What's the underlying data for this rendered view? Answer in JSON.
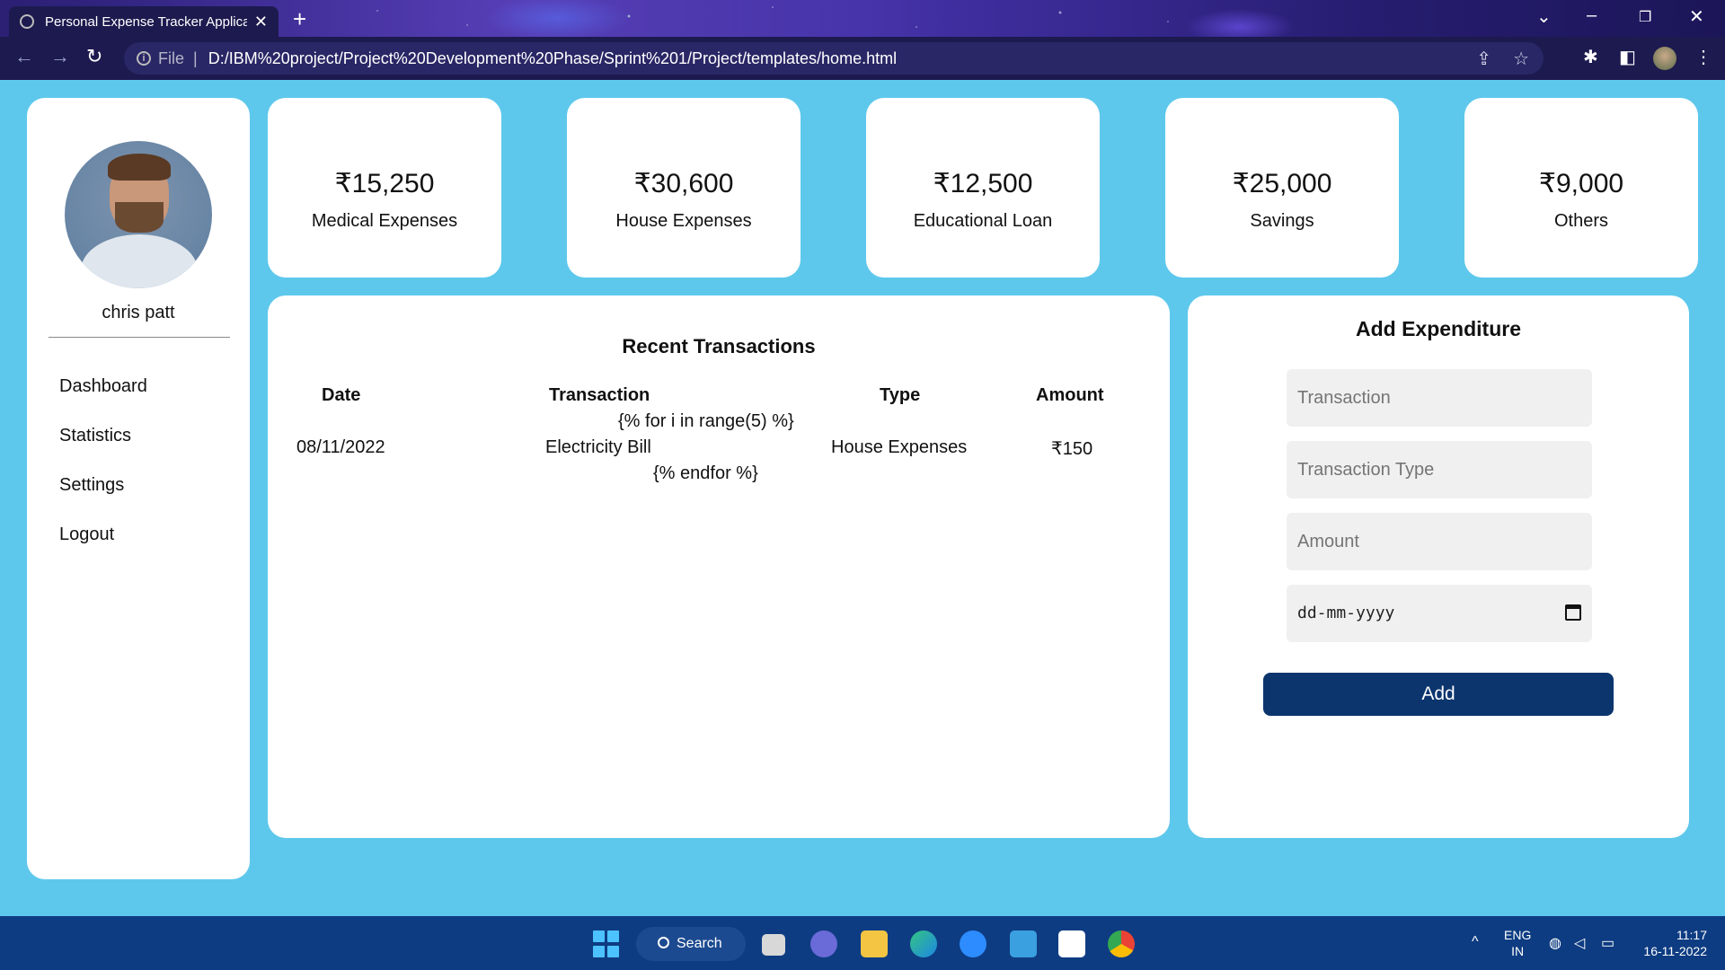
{
  "browser": {
    "tab_title": "Personal Expense Tracker Applica",
    "url_scheme": "File",
    "url": "D:/IBM%20project/Project%20Development%20Phase/Sprint%201/Project/templates/home.html",
    "icons": [
      "back-icon",
      "forward-icon",
      "reload-icon",
      "info-icon",
      "share-icon",
      "star-icon",
      "extensions-icon",
      "sidepanel-icon",
      "menu-icon"
    ]
  },
  "sidebar": {
    "username": "chris patt",
    "nav": [
      {
        "label": "Dashboard"
      },
      {
        "label": "Statistics"
      },
      {
        "label": "Settings"
      },
      {
        "label": "Logout"
      }
    ]
  },
  "stats": [
    {
      "amount": "₹15,250",
      "label": "Medical Expenses"
    },
    {
      "amount": "₹30,600",
      "label": "House Expenses"
    },
    {
      "amount": "₹12,500",
      "label": "Educational Loan"
    },
    {
      "amount": "₹25,000",
      "label": "Savings"
    },
    {
      "amount": "₹9,000",
      "label": "Others"
    }
  ],
  "transactions": {
    "title": "Recent Transactions",
    "headers": {
      "date": "Date",
      "transaction": "Transaction",
      "type": "Type",
      "amount": "Amount"
    },
    "template_for": "{% for i in range(5) %}",
    "template_endfor": "{% endfor %}",
    "rows": [
      {
        "date": "08/11/2022",
        "transaction": "Electricity Bill",
        "type": "House Expenses",
        "amount": "₹150"
      }
    ]
  },
  "add_expenditure": {
    "title": "Add Expenditure",
    "transaction_placeholder": "Transaction",
    "type_placeholder": "Transaction Type",
    "amount_placeholder": "Amount",
    "date_placeholder": "dd-mm-yyyy",
    "add_label": "Add"
  },
  "taskbar": {
    "search_label": "Search",
    "lang_top": "ENG",
    "lang_bottom": "IN",
    "time": "11:17",
    "date": "16-11-2022"
  },
  "colors": {
    "page_bg": "#5ec8ec",
    "button_bg": "#0c356e",
    "taskbar_bg": "#0e3c82"
  }
}
